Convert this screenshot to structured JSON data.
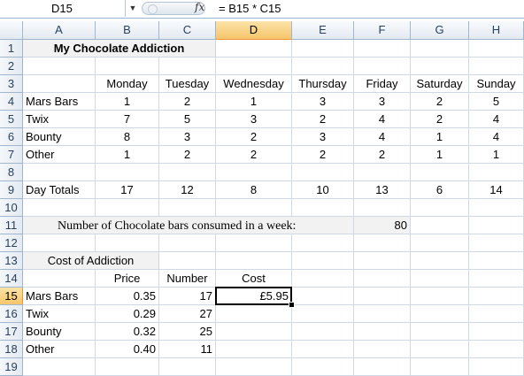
{
  "formula_bar": {
    "name_box": "D15",
    "dropdown_icon": "chevron-down-icon",
    "fx_label": "fx",
    "formula": "= B15 * C15"
  },
  "selected_cell": "D15",
  "columns": [
    "A",
    "B",
    "C",
    "D",
    "E",
    "F",
    "G",
    "H"
  ],
  "rows": [
    "1",
    "2",
    "3",
    "4",
    "5",
    "6",
    "7",
    "8",
    "9",
    "10",
    "11",
    "12",
    "13",
    "14",
    "15",
    "16",
    "17",
    "18",
    "19"
  ],
  "title": "My Chocolate Addiction",
  "days": [
    "Monday",
    "Tuesday",
    "Wednesday",
    "Thursday",
    "Friday",
    "Saturday",
    "Sunday"
  ],
  "consumption": [
    {
      "name": "Mars Bars",
      "values": [
        "1",
        "2",
        "1",
        "3",
        "3",
        "2",
        "5"
      ]
    },
    {
      "name": "Twix",
      "values": [
        "7",
        "5",
        "3",
        "2",
        "4",
        "2",
        "4"
      ]
    },
    {
      "name": "Bounty",
      "values": [
        "8",
        "3",
        "2",
        "3",
        "4",
        "1",
        "4"
      ]
    },
    {
      "name": "Other",
      "values": [
        "1",
        "2",
        "2",
        "2",
        "2",
        "1",
        "1"
      ]
    }
  ],
  "day_totals": {
    "label": "Day Totals",
    "values": [
      "17",
      "12",
      "8",
      "10",
      "13",
      "6",
      "14"
    ]
  },
  "weekly_summary": {
    "label": "Number of Chocolate bars consumed in a week:",
    "value": "80"
  },
  "cost_section": {
    "title": "Cost of Addiction",
    "headers": {
      "price": "Price",
      "number": "Number",
      "cost": "Cost"
    },
    "items": [
      {
        "name": "Mars Bars",
        "price": "0.35",
        "number": "17",
        "cost": "£5.95"
      },
      {
        "name": "Twix",
        "price": "0.29",
        "number": "27",
        "cost": ""
      },
      {
        "name": "Bounty",
        "price": "0.32",
        "number": "25",
        "cost": ""
      },
      {
        "name": "Other",
        "price": "0.40",
        "number": "11",
        "cost": ""
      }
    ]
  },
  "colors": {
    "header_bg": "#e3e9f1",
    "active_header": "#f6c56a",
    "grid_line": "#d0d7e5",
    "shaded_cell": "#f2f2f2"
  }
}
